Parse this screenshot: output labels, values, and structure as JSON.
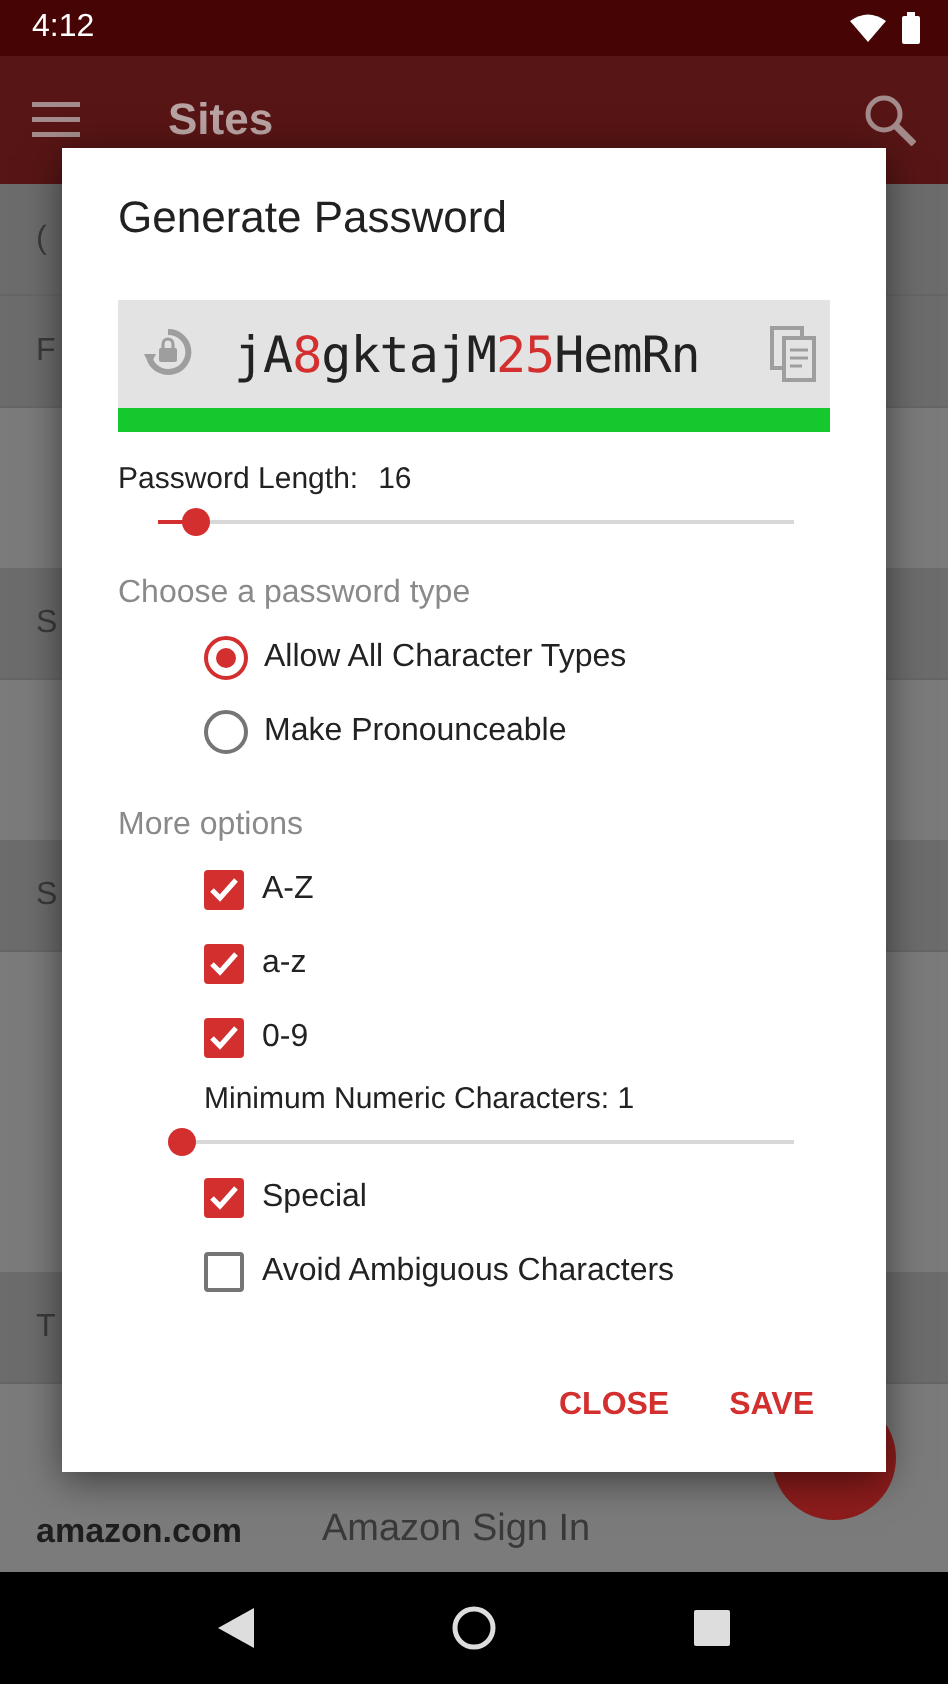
{
  "status_bar": {
    "time": "4:12"
  },
  "app_bar": {
    "title": "Sites"
  },
  "background_list": [
    {
      "kind": "header",
      "text": "("
    },
    {
      "kind": "header",
      "text": "F"
    },
    {
      "kind": "blank"
    },
    {
      "kind": "header",
      "text": "S"
    },
    {
      "kind": "blank"
    },
    {
      "kind": "header",
      "text": "S"
    },
    {
      "kind": "blank"
    },
    {
      "kind": "blank"
    },
    {
      "kind": "header",
      "text": "T"
    },
    {
      "kind": "site",
      "logo": "amazon.com",
      "text": "Amazon Sign In"
    }
  ],
  "dialog": {
    "title": "Generate Password",
    "password": [
      {
        "kind": "letters",
        "text": "jA"
      },
      {
        "kind": "digits",
        "text": "8"
      },
      {
        "kind": "letters",
        "text": "gktajM"
      },
      {
        "kind": "digits",
        "text": "25"
      },
      {
        "kind": "letters",
        "text": "HemRn"
      }
    ],
    "strength": {
      "level": 1
    },
    "length": {
      "label": "Password Length:",
      "value": "16",
      "level": 0.06
    },
    "type_heading": "Choose a password type",
    "types": [
      {
        "label": "Allow All Character Types",
        "selected": true
      },
      {
        "label": "Make Pronounceable",
        "selected": false
      }
    ],
    "options_heading": "More options",
    "options": [
      {
        "kind": "checkbox",
        "label": "A-Z",
        "checked": true
      },
      {
        "kind": "checkbox",
        "label": "a-z",
        "checked": true
      },
      {
        "kind": "checkbox",
        "label": "0-9",
        "checked": true
      },
      {
        "kind": "slider",
        "label": "Minimum Numeric Characters: 1",
        "level": 0
      },
      {
        "kind": "checkbox",
        "label": "Special",
        "checked": true
      },
      {
        "kind": "checkbox",
        "label": "Avoid Ambiguous Characters",
        "checked": false
      }
    ],
    "buttons": [
      "CLOSE",
      "SAVE"
    ]
  }
}
